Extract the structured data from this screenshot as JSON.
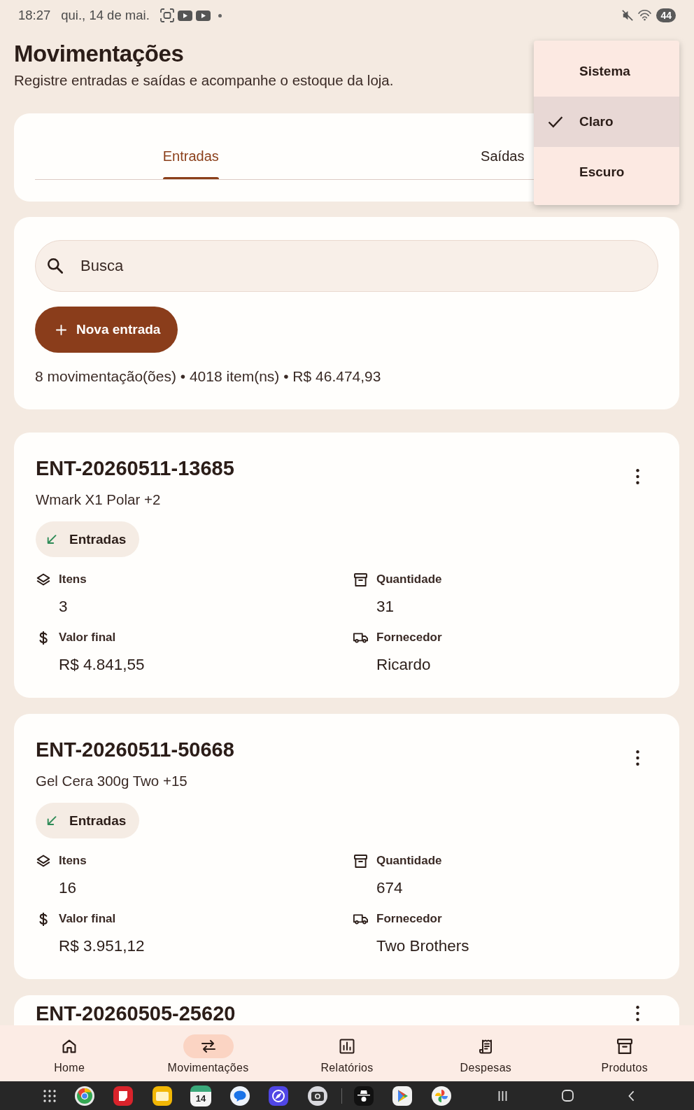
{
  "status_bar": {
    "time": "18:27",
    "date": "qui., 14 de mai.",
    "battery": "44"
  },
  "header": {
    "title": "Movimentações",
    "subtitle": "Registre entradas e saídas e acompanhe o estoque da loja."
  },
  "tabs": [
    {
      "label": "Entradas",
      "selected": true
    },
    {
      "label": "Saídas",
      "selected": false
    }
  ],
  "search": {
    "placeholder": "Busca"
  },
  "new_button": {
    "label": "Nova entrada"
  },
  "summary": "8 movimentação(ões) • 4018 item(ns) • R$ 46.474,93",
  "entries": [
    {
      "code": "ENT-20260511-13685",
      "description": "Wmark X1 Polar +2",
      "badge": "Entradas",
      "fields": [
        {
          "label": "Itens",
          "value": "3"
        },
        {
          "label": "Quantidade",
          "value": "31"
        },
        {
          "label": "Valor final",
          "value": "R$ 4.841,55"
        },
        {
          "label": "Fornecedor",
          "value": "Ricardo"
        }
      ]
    },
    {
      "code": "ENT-20260511-50668",
      "description": "Gel Cera 300g Two +15",
      "badge": "Entradas",
      "fields": [
        {
          "label": "Itens",
          "value": "16"
        },
        {
          "label": "Quantidade",
          "value": "674"
        },
        {
          "label": "Valor final",
          "value": "R$ 3.951,12"
        },
        {
          "label": "Fornecedor",
          "value": "Two Brothers"
        }
      ]
    },
    {
      "code": "ENT-20260505-25620"
    }
  ],
  "theme_menu": [
    {
      "label": "Sistema",
      "selected": false
    },
    {
      "label": "Claro",
      "selected": true
    },
    {
      "label": "Escuro",
      "selected": false
    }
  ],
  "bottom_nav": [
    {
      "label": "Home",
      "selected": false
    },
    {
      "label": "Movimentações",
      "selected": true
    },
    {
      "label": "Relatórios",
      "selected": false
    },
    {
      "label": "Despesas",
      "selected": false
    },
    {
      "label": "Produtos",
      "selected": false
    }
  ],
  "taskbar": {
    "calendar_day": "14"
  }
}
